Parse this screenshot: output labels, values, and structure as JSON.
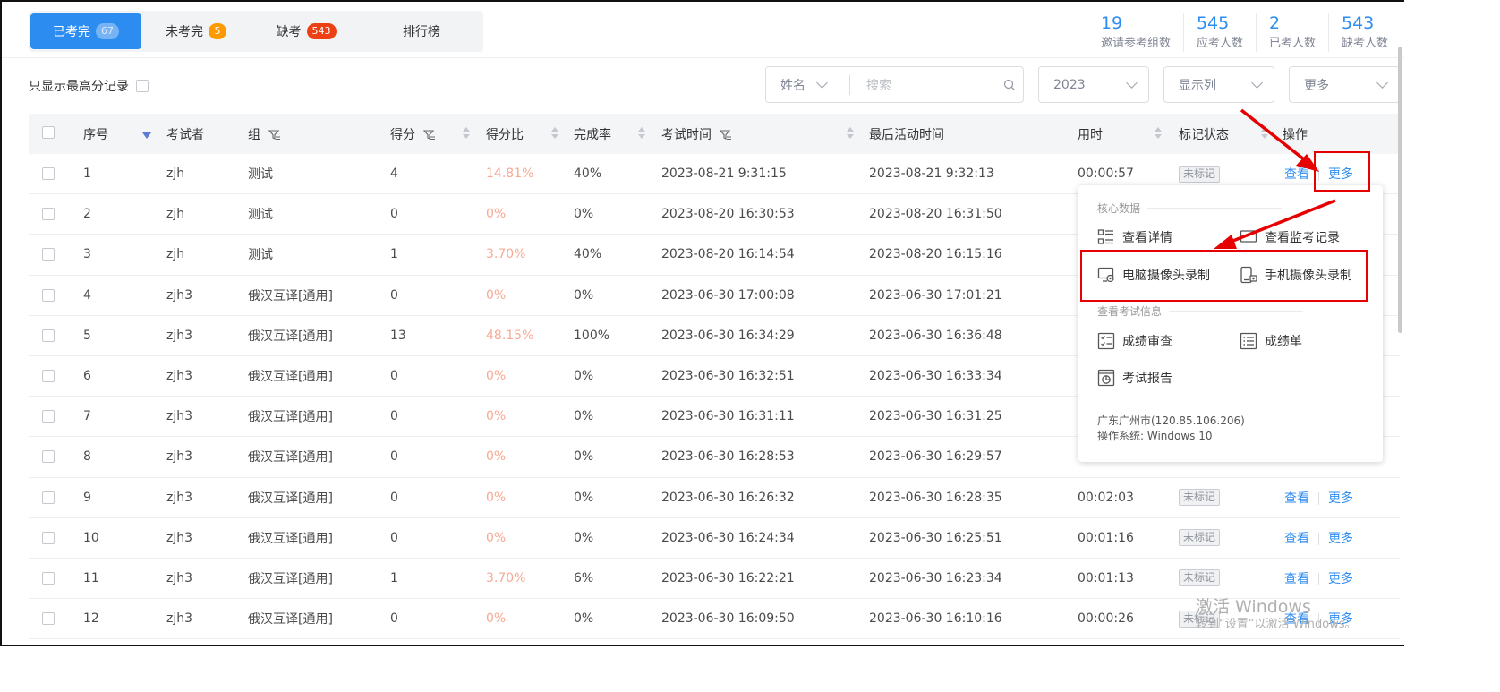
{
  "tabs": [
    {
      "label": "已考完",
      "badge": "67"
    },
    {
      "label": "未考完",
      "badge": "5"
    },
    {
      "label": "缺考",
      "badge": "543"
    },
    {
      "label": "排行榜"
    }
  ],
  "stats": [
    {
      "value": "19",
      "label": "邀请参考组数"
    },
    {
      "value": "545",
      "label": "应考人数"
    },
    {
      "value": "2",
      "label": "已考人数"
    },
    {
      "value": "543",
      "label": "缺考人数"
    }
  ],
  "filters": {
    "only_top_label": "只显示最高分记录",
    "search_field": "姓名",
    "search_placeholder": "搜索",
    "year": "2023",
    "columns_label": "显示列",
    "more_label": "更多"
  },
  "table": {
    "headers": {
      "index": "序号",
      "examinee": "考试者",
      "group": "组",
      "score": "得分",
      "percent": "得分比",
      "completion": "完成率",
      "exam_time": "考试时间",
      "last_active": "最后活动时间",
      "duration": "用时",
      "mark": "标记状态",
      "op": "操作"
    },
    "rows": [
      {
        "index": "1",
        "examinee": "zjh",
        "group": "测试",
        "score": "4",
        "percent": "14.81%",
        "completion": "40%",
        "exam_time": "2023-08-21 9:31:15",
        "last_active": "2023-08-21 9:32:13",
        "duration": "00:00:57",
        "mark": "未标记"
      },
      {
        "index": "2",
        "examinee": "zjh",
        "group": "测试",
        "score": "0",
        "percent": "0%",
        "completion": "0%",
        "exam_time": "2023-08-20 16:30:53",
        "last_active": "2023-08-20 16:31:50",
        "duration": "",
        "mark": ""
      },
      {
        "index": "3",
        "examinee": "zjh",
        "group": "测试",
        "score": "1",
        "percent": "3.70%",
        "completion": "40%",
        "exam_time": "2023-08-20 16:14:54",
        "last_active": "2023-08-20 16:15:16",
        "duration": "",
        "mark": ""
      },
      {
        "index": "4",
        "examinee": "zjh3",
        "group": "俄汉互译[通用]",
        "score": "0",
        "percent": "0%",
        "completion": "0%",
        "exam_time": "2023-06-30 17:00:08",
        "last_active": "2023-06-30 17:01:21",
        "duration": "",
        "mark": ""
      },
      {
        "index": "5",
        "examinee": "zjh3",
        "group": "俄汉互译[通用]",
        "score": "13",
        "percent": "48.15%",
        "completion": "100%",
        "exam_time": "2023-06-30 16:34:29",
        "last_active": "2023-06-30 16:36:48",
        "duration": "",
        "mark": ""
      },
      {
        "index": "6",
        "examinee": "zjh3",
        "group": "俄汉互译[通用]",
        "score": "0",
        "percent": "0%",
        "completion": "0%",
        "exam_time": "2023-06-30 16:32:51",
        "last_active": "2023-06-30 16:33:34",
        "duration": "",
        "mark": ""
      },
      {
        "index": "7",
        "examinee": "zjh3",
        "group": "俄汉互译[通用]",
        "score": "0",
        "percent": "0%",
        "completion": "0%",
        "exam_time": "2023-06-30 16:31:11",
        "last_active": "2023-06-30 16:31:25",
        "duration": "",
        "mark": ""
      },
      {
        "index": "8",
        "examinee": "zjh3",
        "group": "俄汉互译[通用]",
        "score": "0",
        "percent": "0%",
        "completion": "0%",
        "exam_time": "2023-06-30 16:28:53",
        "last_active": "2023-06-30 16:29:57",
        "duration": "",
        "mark": ""
      },
      {
        "index": "9",
        "examinee": "zjh3",
        "group": "俄汉互译[通用]",
        "score": "0",
        "percent": "0%",
        "completion": "0%",
        "exam_time": "2023-06-30 16:26:32",
        "last_active": "2023-06-30 16:28:35",
        "duration": "00:02:03",
        "mark": "未标记"
      },
      {
        "index": "10",
        "examinee": "zjh3",
        "group": "俄汉互译[通用]",
        "score": "0",
        "percent": "0%",
        "completion": "0%",
        "exam_time": "2023-06-30 16:24:34",
        "last_active": "2023-06-30 16:25:51",
        "duration": "00:01:16",
        "mark": "未标记"
      },
      {
        "index": "11",
        "examinee": "zjh3",
        "group": "俄汉互译[通用]",
        "score": "1",
        "percent": "3.70%",
        "completion": "6%",
        "exam_time": "2023-06-30 16:22:21",
        "last_active": "2023-06-30 16:23:34",
        "duration": "00:01:13",
        "mark": "未标记"
      },
      {
        "index": "12",
        "examinee": "zjh3",
        "group": "俄汉互译[通用]",
        "score": "0",
        "percent": "0%",
        "completion": "0%",
        "exam_time": "2023-06-30 16:09:50",
        "last_active": "2023-06-30 16:10:16",
        "duration": "00:00:26",
        "mark": "未标记"
      }
    ],
    "view_label": "查看",
    "more_label": "更多"
  },
  "dropdown": {
    "section_core": "核心数据",
    "view_details": "查看详情",
    "view_monitor": "查看监考记录",
    "pc_camera": "电脑摄像头录制",
    "phone_camera": "手机摄像头录制",
    "section_exam": "查看考试信息",
    "score_review": "成绩审查",
    "score_sheet": "成绩单",
    "exam_report": "考试报告",
    "location": "广东广州市(120.85.106.206)",
    "os": "操作系统: Windows 10"
  },
  "watermark": {
    "title": "激活 Windows",
    "subtitle": "转到“设置”以激活 Windows。"
  },
  "colors": {
    "primary": "#2d8cf0",
    "annotation": "#e60000",
    "percent": "#f8a994"
  }
}
